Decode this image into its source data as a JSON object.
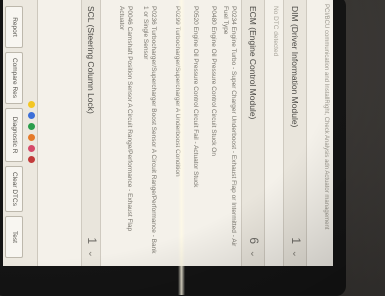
{
  "header_text": "PCI/BCU communication and InstallRight, Check Analysis adn Actuator management",
  "sections": [
    {
      "title": "DIM (Driver Information Module)",
      "count": "1",
      "lines": [
        "No DTC detected"
      ]
    },
    {
      "title": "ECM (Engine Control Module)",
      "count": "6",
      "lines": [
        "P0234 Engine Turbo - Super Charger Underboost - Exhaust Flap or Intermitted - Air Fuel Type",
        "P0480 Engine Oil Pressure Control Circuit Stuck On",
        "P0520 Engine Oil Pressure Control Circuit Fail - Actuator Stuck",
        "P0299 Turbocharger/Supercharger A Underboost Condition",
        "P0236 Turbocharger/Supercharger Boost Sensor A Circuit Range/Performance - Bank 1 or Single Sensor",
        "P0046 Camshaft Position Sensor A Circuit Range/Performance - Exhaust Flap Actuator"
      ]
    },
    {
      "title": "SCL (Steering Column Lock)",
      "count": "1",
      "lines": []
    }
  ],
  "toolbar": {
    "buttons": [
      "Report",
      "Compare Res",
      "Diagnostic R",
      "Clear DTCs",
      "Test"
    ]
  },
  "status_colors": [
    "#f3c623",
    "#3c6fd8",
    "#2a9d4b",
    "#e57a2a",
    "#d64a6a",
    "#c23a3a"
  ]
}
